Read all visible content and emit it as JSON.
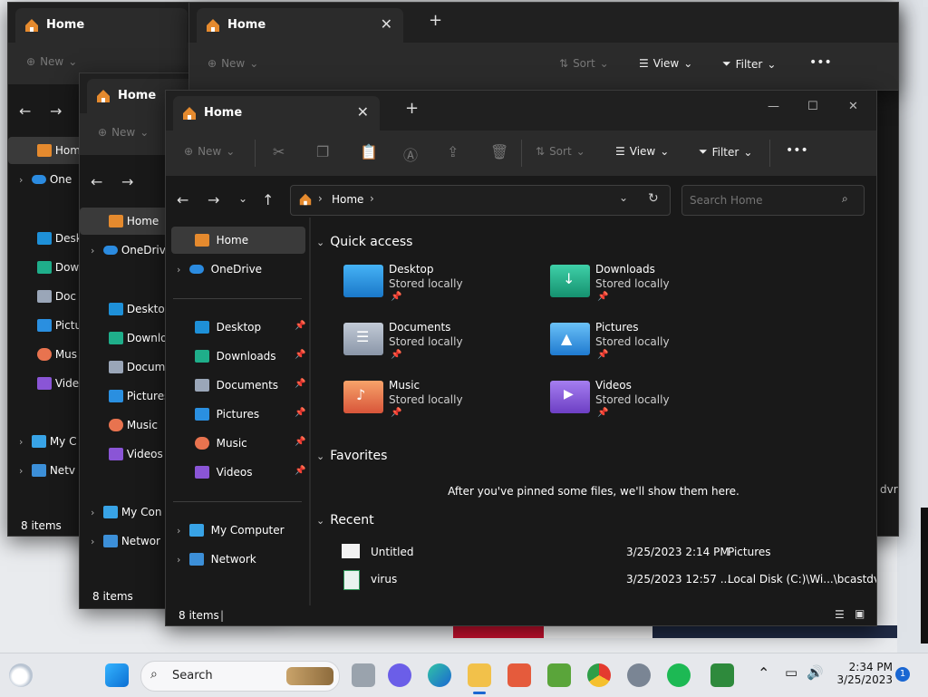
{
  "window": {
    "tab_title": "Home",
    "toolbar": {
      "new": "New",
      "sort": "Sort",
      "view": "View",
      "filter": "Filter",
      "more": "•••"
    },
    "address": {
      "crumb": "Home",
      "search_placeholder": "Search Home"
    },
    "sidebar": {
      "home": "Home",
      "onedrive": "OneDrive",
      "pinned": [
        {
          "label": "Desktop"
        },
        {
          "label": "Downloads"
        },
        {
          "label": "Documents"
        },
        {
          "label": "Pictures"
        },
        {
          "label": "Music"
        },
        {
          "label": "Videos"
        }
      ],
      "my_computer": "My Computer",
      "network": "Network"
    },
    "status": "8 items"
  },
  "back_windows": {
    "w1": {
      "sidebar": [
        "Hom",
        "One",
        "Desk",
        "Dow",
        "Doc",
        "Pictu",
        "Mus",
        "Vide",
        "My C",
        "Netv"
      ],
      "status": "8 items",
      "edge_text": "dvr"
    },
    "w2": {
      "sidebar": [
        "Home",
        "OneDriv",
        "Desktop",
        "Downlo",
        "Docume",
        "Pictures",
        "Music",
        "Videos",
        "My Con",
        "Networ"
      ],
      "status": "8 items"
    }
  },
  "content": {
    "quick_access": {
      "title": "Quick access",
      "items": [
        {
          "name": "Desktop",
          "sub": "Stored locally",
          "color": "#1e90d8"
        },
        {
          "name": "Downloads",
          "sub": "Stored locally",
          "color": "#1fae8a"
        },
        {
          "name": "Documents",
          "sub": "Stored locally",
          "color": "#9aa6b8"
        },
        {
          "name": "Pictures",
          "sub": "Stored locally",
          "color": "#2a8fe0"
        },
        {
          "name": "Music",
          "sub": "Stored locally",
          "color": "#e8734f"
        },
        {
          "name": "Videos",
          "sub": "Stored locally",
          "color": "#8a55d6"
        }
      ]
    },
    "favorites": {
      "title": "Favorites",
      "empty": "After you've pinned some files, we'll show them here."
    },
    "recent": {
      "title": "Recent",
      "items": [
        {
          "name": "Untitled",
          "date": "3/25/2023 2:14 PM",
          "location": "Pictures"
        },
        {
          "name": "virus",
          "date": "3/25/2023 12:57 ...",
          "location": "Local Disk (C:)\\Wi...\\bcastdvr"
        }
      ]
    }
  },
  "taskbar": {
    "search": "Search",
    "time": "2:34 PM",
    "date": "3/25/2023",
    "notification_count": "1"
  }
}
